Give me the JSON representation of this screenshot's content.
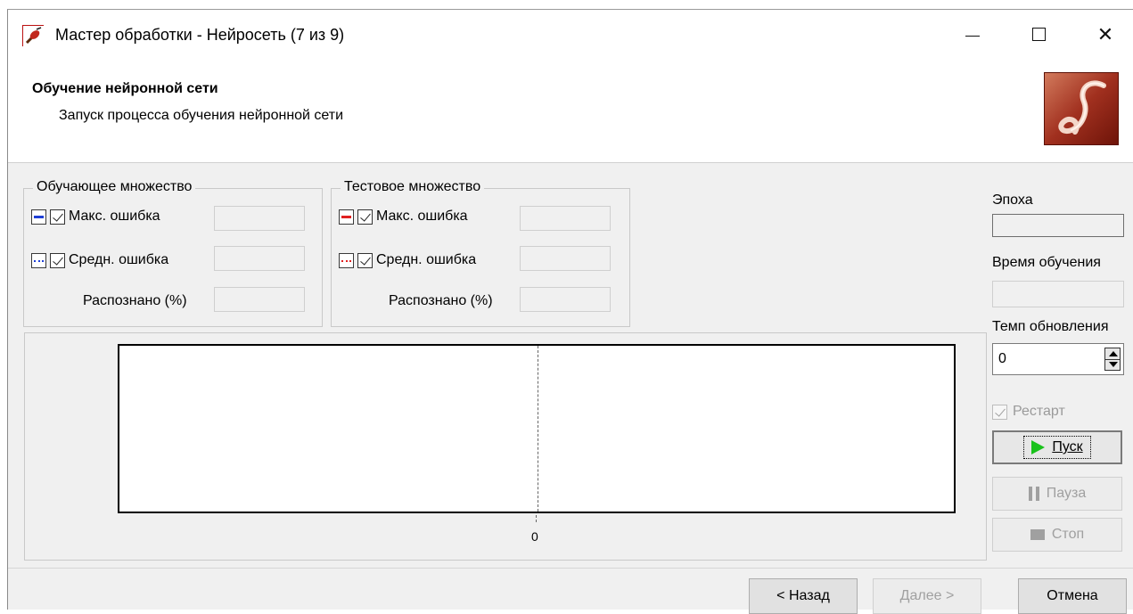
{
  "window": {
    "title": "Мастер обработки - Нейросеть (7 из 9)"
  },
  "header": {
    "title": "Обучение нейронной сети",
    "subtitle": "Запуск процесса обучения нейронной сети"
  },
  "training_set": {
    "label": "Обучающее множество",
    "max_error_label": "Макс. ошибка",
    "avg_error_label": "Средн. ошибка",
    "recognized_label": "Распознано (%)",
    "max_error_value": "",
    "avg_error_value": "",
    "recognized_value": "",
    "max_error_checked": true,
    "avg_error_checked": true,
    "max_error_color": "#1f3fd6",
    "avg_error_color": "#1f3fd6"
  },
  "test_set": {
    "label": "Тестовое множество",
    "max_error_label": "Макс. ошибка",
    "avg_error_label": "Средн. ошибка",
    "recognized_label": "Распознано (%)",
    "max_error_value": "",
    "avg_error_value": "",
    "recognized_value": "",
    "max_error_checked": true,
    "avg_error_checked": true,
    "max_error_color": "#e02020",
    "avg_error_color": "#e02020"
  },
  "chart": {
    "x_tick": "0"
  },
  "side": {
    "epoch_label": "Эпоха",
    "epoch_value": "",
    "time_label": "Время обучения",
    "time_value": "",
    "rate_label": "Темп обновления",
    "rate_value": "0",
    "restart_label": "Рестарт",
    "restart_checked": true
  },
  "buttons": {
    "start": "Пуск",
    "pause": "Пауза",
    "stop": "Стоп",
    "back": "< Назад",
    "next": "Далее >",
    "cancel": "Отмена"
  },
  "icons": {
    "app": "violin-icon",
    "logo": "deductor-logo-icon"
  }
}
